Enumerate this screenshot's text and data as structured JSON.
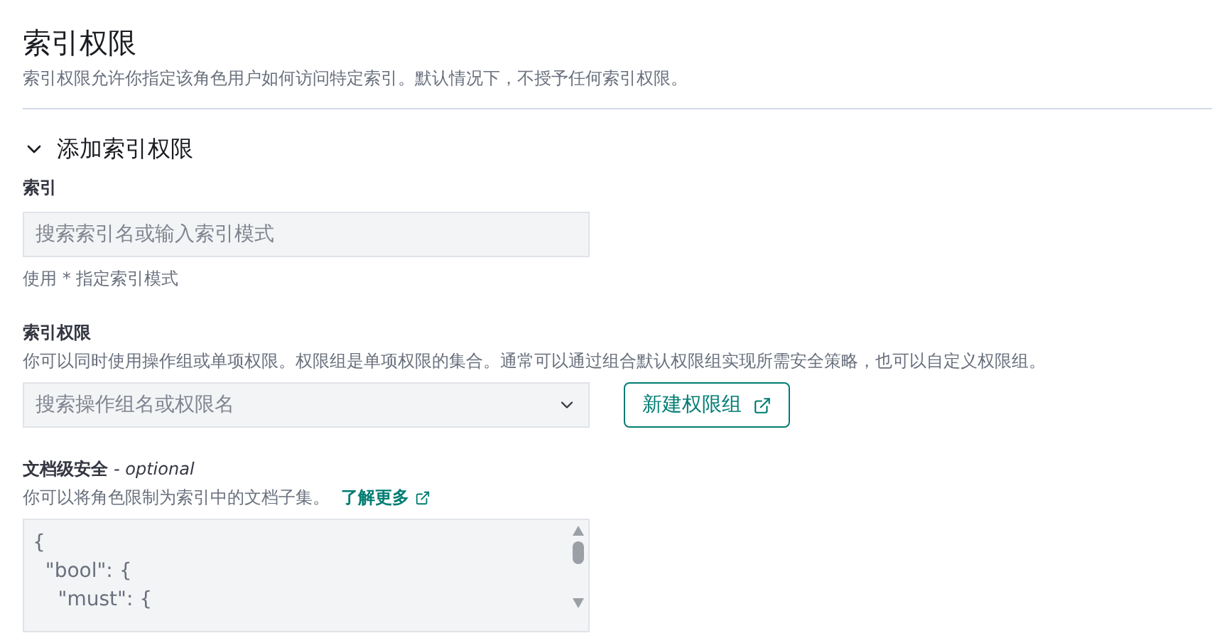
{
  "header": {
    "title": "索引权限",
    "description": "索引权限允许你指定该角色用户如何访问特定索引。默认情况下，不授予任何索引权限。"
  },
  "section": {
    "title": "添加索引权限",
    "expanded": true
  },
  "index_field": {
    "label": "索引",
    "placeholder": "搜索索引名或输入索引模式",
    "help": "使用 * 指定索引模式"
  },
  "privileges_field": {
    "label": "索引权限",
    "description": "你可以同时使用操作组或单项权限。权限组是单项权限的集合。通常可以通过组合默认权限组实现所需安全策略，也可以自定义权限组。",
    "placeholder": "搜索操作组名或权限名",
    "button": "新建权限组"
  },
  "dls_field": {
    "label": "文档级安全",
    "label_suffix": "- optional",
    "description": "你可以将角色限制为索引中的文档子集。",
    "link": "了解更多",
    "code_lines": [
      "{",
      "  \"bool\": {",
      "    \"must\": {"
    ]
  }
}
